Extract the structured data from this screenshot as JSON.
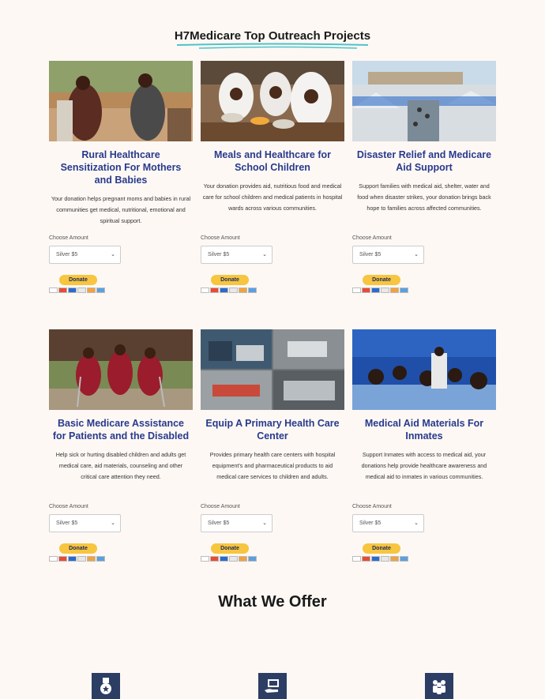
{
  "page_title": "H7Medicare Top Outreach Projects",
  "choose_label": "Choose Amount",
  "select_value": "Silver $5",
  "donate_label": "Donate",
  "projects": [
    {
      "title": "Rural Healthcare Sensitization For Mothers and Babies",
      "desc": "Your donation helps pregnant moms  and babies in rural communities get medical, nutritional, emotional and spiritual support."
    },
    {
      "title": "Meals and Healthcare for School Children",
      "desc": "Your donation provides aid, nutritious food and medical care for school children and medical patients in hospital wards across various communities."
    },
    {
      "title": "Disaster Relief and Medicare Aid Support",
      "desc": "Support families with medical aid, shelter, water and food when disaster strikes, your donation brings back hope to families across affected communities."
    },
    {
      "title": "Basic Medicare Assistance for Patients and the Disabled",
      "desc": "Help sick or hurting disabled children and adults get medical care,  aid materials, counseling and other critical care attention they need."
    },
    {
      "title": "Equip A Primary Health Care Center",
      "desc": "Provides primary health care centers with hospital equipment's and pharmaceutical  products to aid medical care  services to children and adults."
    },
    {
      "title": "Medical Aid Materials For Inmates",
      "desc": "Support Inmates with access to medical aid, your donations help provide healthcare awareness and medical aid to inmates in various communities."
    }
  ],
  "offer_title": "What We Offer",
  "offer_icons": [
    "medal-icon",
    "hand-laptop-icon",
    "people-group-icon"
  ],
  "colors": {
    "accent": "#283a8c",
    "underline": "#4fc3c9",
    "donate": "#f7c53f",
    "icon_bg": "#2c3e63",
    "background": "#fdf8f4"
  }
}
